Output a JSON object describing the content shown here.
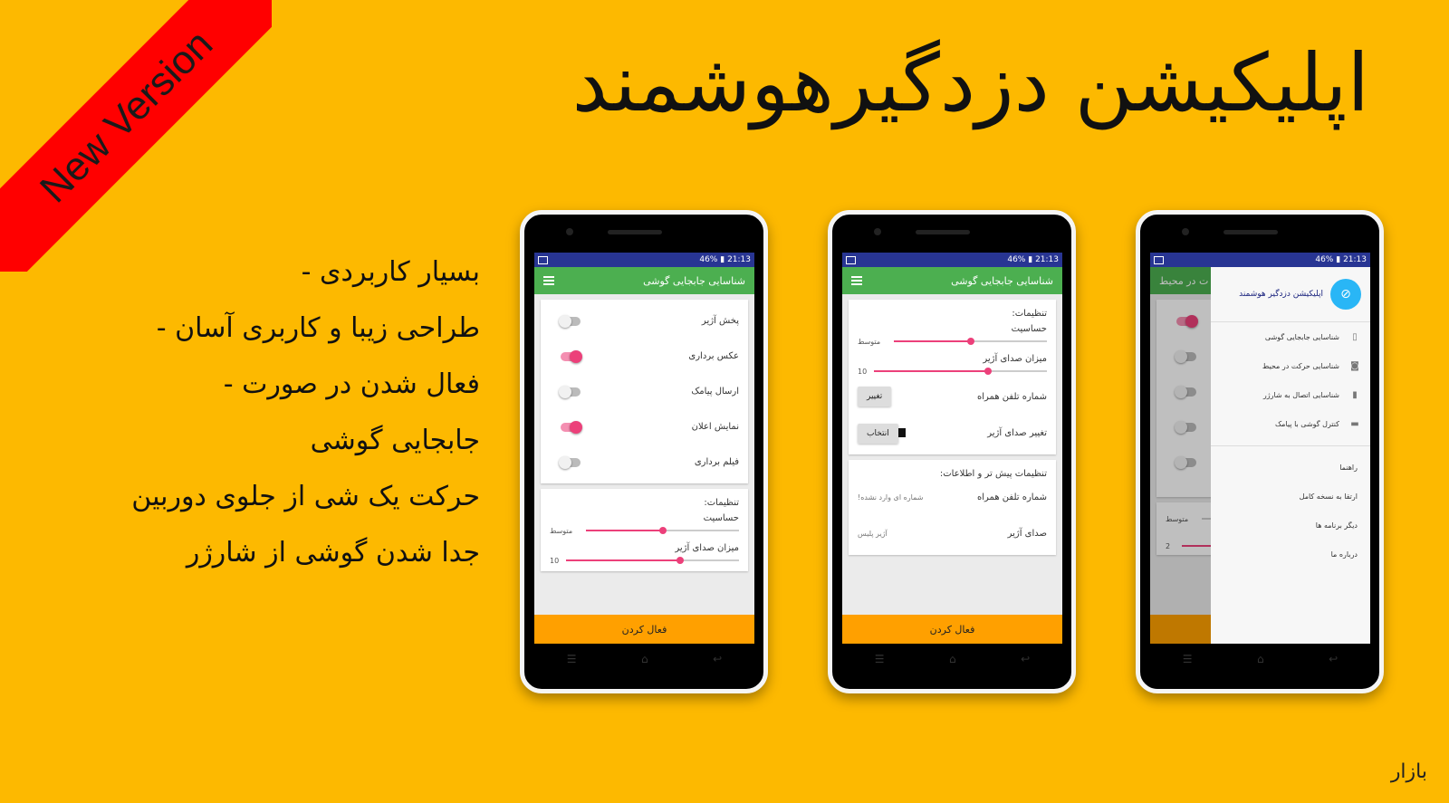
{
  "banner": {
    "label": "New Version",
    "color": "#ff0000"
  },
  "title": "اپلیکیشن دزدگیرهوشمند",
  "features": [
    {
      "text": "بسیار کاربردی",
      "dash": "-"
    },
    {
      "text": "طراحی زیبا و کاربری آسان",
      "dash": "-"
    },
    {
      "text": "فعال شدن در صورت",
      "dash": "-"
    },
    {
      "text": "جابجایی گوشی",
      "dash": ""
    },
    {
      "text": "حرکت یک شی از جلوی دوربین",
      "dash": ""
    },
    {
      "text": "جدا شدن گوشی از شارژر",
      "dash": ""
    }
  ],
  "statusbar": {
    "battery": "46%",
    "time": "21:13"
  },
  "phone1": {
    "appbar_title": "شناسایی جابجایی گوشی",
    "switches": [
      {
        "label": "پخش آژیر",
        "on": false
      },
      {
        "label": "عکس برداری",
        "on": true
      },
      {
        "label": "ارسال پیامک",
        "on": false
      },
      {
        "label": "نمایش اعلان",
        "on": true
      },
      {
        "label": "فیلم برداری",
        "on": false
      }
    ],
    "settings_title": "تنظیمات:",
    "sensitivity_label": "حساسیت",
    "sensitivity_value": "متوسط",
    "volume_label": "میزان صدای آژیر",
    "volume_value": "10",
    "activate_label": "فعال کردن"
  },
  "phone2": {
    "appbar_title": "شناسایی جابجایی گوشی",
    "settings_title": "تنظیمات:",
    "sensitivity_label": "حساسیت",
    "sensitivity_value": "متوسط",
    "volume_label": "میزان صدای آژیر",
    "volume_value": "10",
    "phone_label": "شماره تلفن همراه",
    "change_button": "تغییر",
    "alarm_change_label": "تغییر صدای آژیر",
    "select_button": "انتخاب",
    "advanced_title": "تنظیمات پیش تر و اطلاعات:",
    "info_phone_label": "شماره تلفن همراه",
    "info_phone_value": "شماره ای وارد نشده!",
    "info_alarm_label": "صدای آژیر",
    "info_alarm_value": "آژیر پلیس",
    "activate_label": "فعال کردن"
  },
  "phone3": {
    "appbar_partial": "ت در محیط",
    "drawer_title": "اپلیکیشن دزدگیر هوشمند",
    "drawer_items": [
      {
        "label": "شناسایی جابجایی گوشی",
        "icon": "vibrate-icon"
      },
      {
        "label": "شناسایی حرکت در محیط",
        "icon": "camera-icon"
      },
      {
        "label": "شناسایی اتصال به شارژر",
        "icon": "battery-icon"
      },
      {
        "label": "کنترل گوشی با پیامک",
        "icon": "message-icon"
      }
    ],
    "drawer_links": [
      "راهنما",
      "ارتقا به نسخه کامل",
      "دیگر برنامه ها",
      "درباره ما"
    ],
    "sensitivity_value": "متوسط",
    "volume_value": "2"
  },
  "watermark": "بازار"
}
